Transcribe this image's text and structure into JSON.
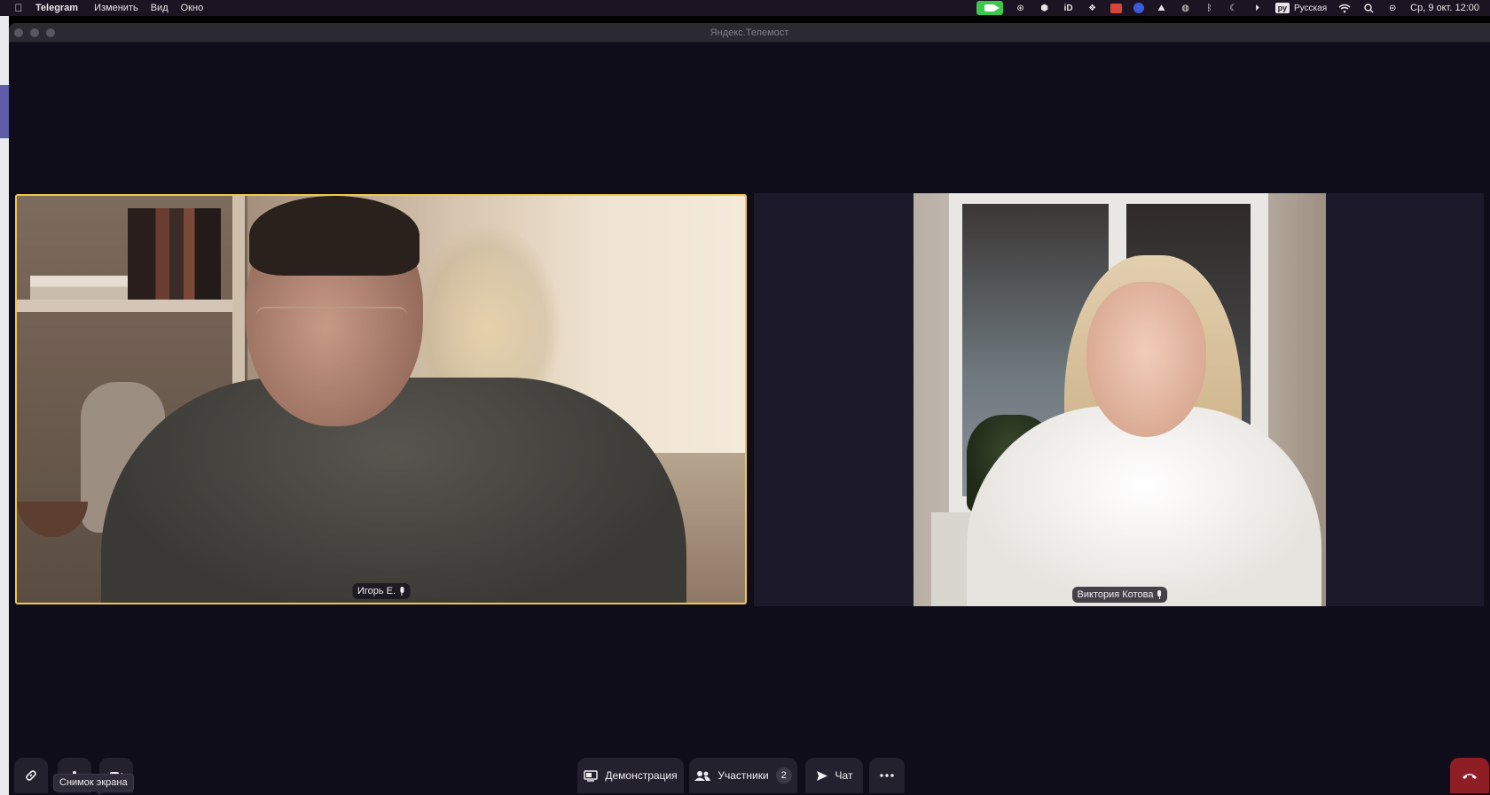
{
  "menubar": {
    "app_name": "Telegram",
    "items": [
      "Изменить",
      "Вид",
      "Окно"
    ],
    "input_source": "ру",
    "input_language": "Русская",
    "clock": "Ср, 9 окт.  12:00"
  },
  "window": {
    "title": "Яндекс.Телемост"
  },
  "participants": [
    {
      "name": "Игорь Е.",
      "speaking": true
    },
    {
      "name": "Виктория Котова",
      "speaking": false
    }
  ],
  "toolbar": {
    "demo_label": "Демонстрация",
    "participants_label": "Участники",
    "participants_count": "2",
    "chat_label": "Чат",
    "tooltip": "Снимок экрана"
  },
  "colors": {
    "active_speaker_border": "#f1c84a",
    "hangup": "#8e1d24",
    "background": "#100d1b"
  }
}
